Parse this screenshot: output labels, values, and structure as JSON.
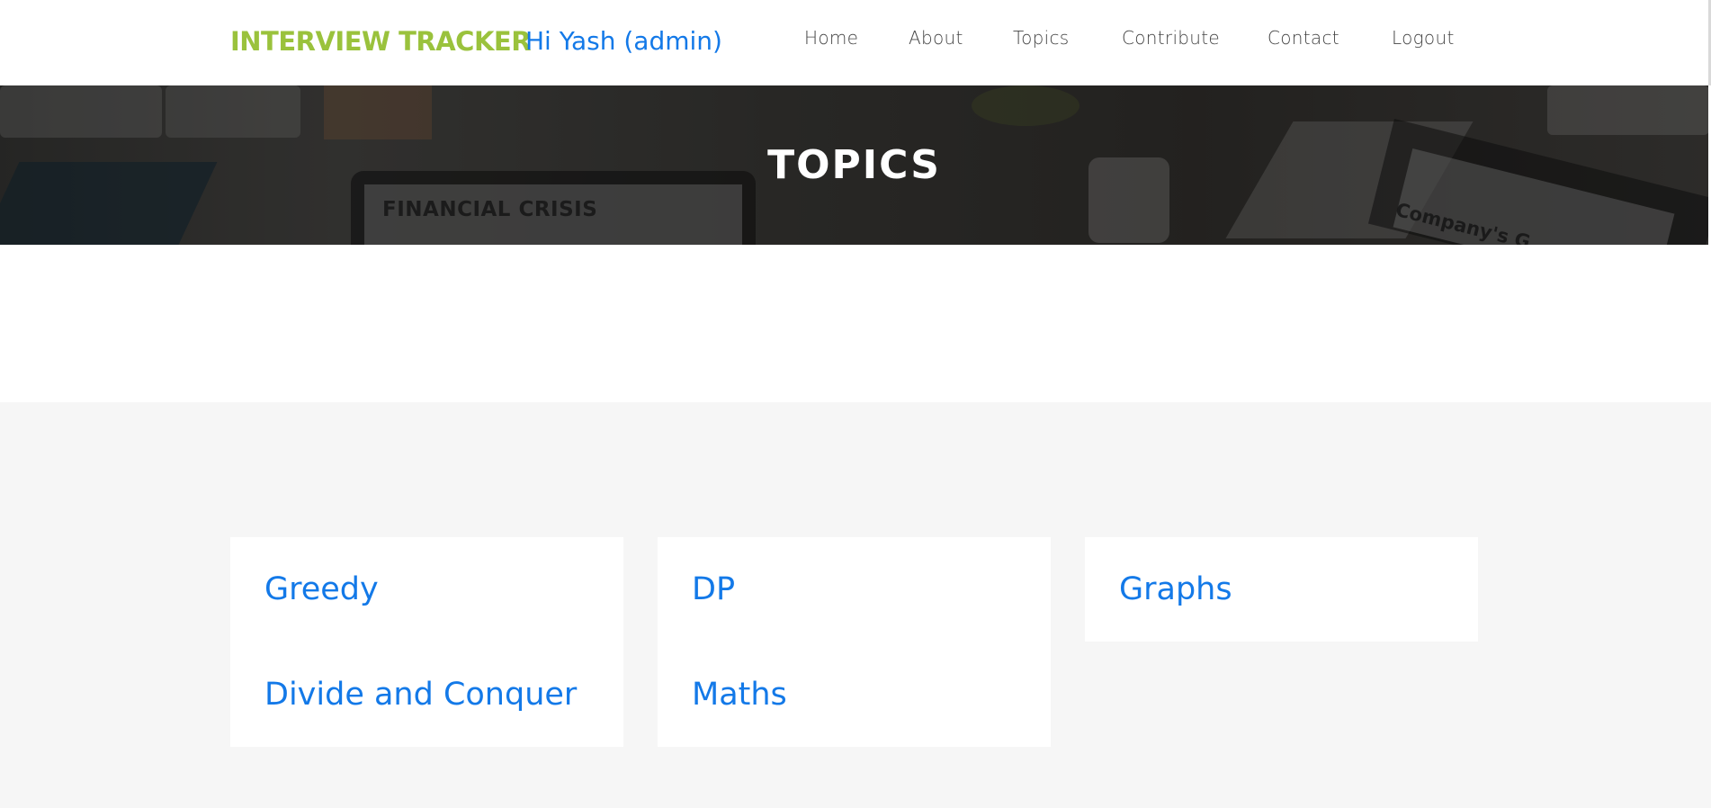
{
  "header": {
    "brand": "INTERVIEW TRACKER",
    "greeting": "Hi Yash (admin)",
    "nav": {
      "home": "Home",
      "about": "About",
      "topics": "Topics",
      "contribute": "Contribute",
      "contact": "Contact",
      "logout": "Logout"
    }
  },
  "banner": {
    "title": "TOPICS",
    "image_text_left": "FINANCIAL CRISIS",
    "image_text_right": "Company's G"
  },
  "topics": {
    "card1": [
      "Greedy",
      "Divide and Conquer"
    ],
    "card2": [
      "DP",
      "Maths"
    ],
    "card3": [
      "Graphs"
    ]
  },
  "colors": {
    "brand": "#9ac23c",
    "link": "#1379e8",
    "nav_text": "#444444",
    "section_bg": "#f6f6f6"
  }
}
